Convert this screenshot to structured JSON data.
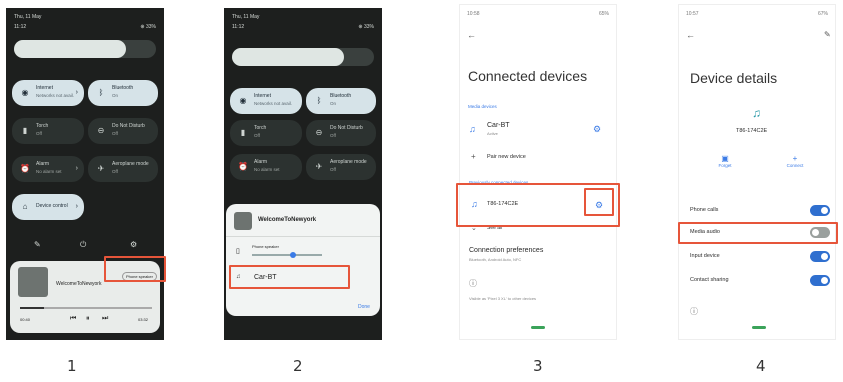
{
  "screen1": {
    "date": "Thu, 11 May",
    "time": "11:12",
    "battery": "⊕ 33%",
    "tiles": [
      {
        "label": "Internet",
        "sub": "Networks not avail.",
        "icon": "wifi-icon"
      },
      {
        "label": "Bluetooth",
        "sub": "On",
        "icon": "bluetooth-icon"
      },
      {
        "label": "Torch",
        "sub": "Off",
        "icon": "flashlight-icon"
      },
      {
        "label": "Do Not Disturb",
        "sub": "Off",
        "icon": "dnd-icon"
      },
      {
        "label": "Alarm",
        "sub": "No alarm set",
        "icon": "alarm-icon"
      },
      {
        "label": "Aeroplane mode",
        "sub": "Off",
        "icon": "airplane-icon"
      },
      {
        "label": "Device control",
        "sub": "",
        "icon": "home-icon"
      }
    ],
    "media_title": "WelcomeToNewyork",
    "output_chip": "Phone speaker",
    "time_elapsed": "00:40",
    "time_total": "03:32"
  },
  "screen2": {
    "date": "Thu, 11 May",
    "time": "11:12",
    "battery": "⊕ 33%",
    "tiles": [
      {
        "label": "Internet",
        "sub": "Networks not avail."
      },
      {
        "label": "Bluetooth",
        "sub": "On"
      },
      {
        "label": "Torch",
        "sub": "Off"
      },
      {
        "label": "Do Not Disturb",
        "sub": "Off"
      },
      {
        "label": "Alarm",
        "sub": "No alarm set"
      },
      {
        "label": "Aeroplane mode",
        "sub": "Off"
      }
    ],
    "popup_title": "WelcomeToNewyork",
    "phone_speaker": "Phone speaker",
    "car_bt": "Car-BT",
    "done": "Done"
  },
  "screen3": {
    "status_time": "10:58",
    "battery": "65%",
    "title": "Connected devices",
    "section_media": "Media devices",
    "car_bt": "Car-BT",
    "car_bt_sub": "Active",
    "pair_new": "Pair new device",
    "section_prev": "Previously connected devices",
    "t86": "T86-174C2E",
    "see_all": "See all",
    "conn_prefs": "Connection preferences",
    "conn_prefs_sub": "Bluetooth, Android Auto, NFC",
    "visible_as": "Visible as 'Pixel 3 XL' to other devices"
  },
  "screen4": {
    "status_time": "10:57",
    "battery": "67%",
    "title": "Device details",
    "device_name": "T86-174C2E",
    "forget": "Forget",
    "connect": "Connect",
    "toggles": [
      {
        "label": "Phone calls",
        "state": "on"
      },
      {
        "label": "Media audio",
        "state": "off"
      },
      {
        "label": "Input device",
        "state": "on"
      },
      {
        "label": "Contact sharing",
        "state": "on"
      }
    ]
  },
  "steps": [
    "1",
    "2",
    "3",
    "4"
  ],
  "colors": {
    "highlight": "#e6553a",
    "toggle_on": "#2f6fcf",
    "accent": "#3b7be6"
  }
}
